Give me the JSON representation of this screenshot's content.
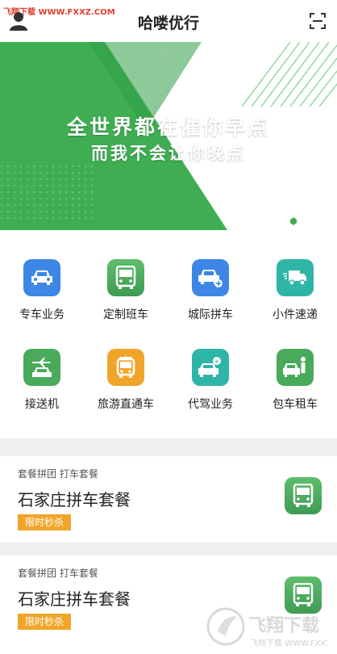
{
  "header": {
    "watermark": "飞翔下载 WWW.FXXZ.COM",
    "title": "哈喽优行"
  },
  "banner": {
    "line1": "全世界都在催你早点",
    "line2": "而我不会让你晚点"
  },
  "services": [
    {
      "label": "专车业务",
      "icon": "car-icon",
      "color": "#3d86e6"
    },
    {
      "label": "定制班车",
      "icon": "bus-icon",
      "color": "#4aaa5c"
    },
    {
      "label": "城际拼车",
      "icon": "car-plus-icon",
      "color": "#3d86e6"
    },
    {
      "label": "小件速递",
      "icon": "truck-icon",
      "color": "#2fb5a8"
    },
    {
      "label": "接送机",
      "icon": "plane-car-icon",
      "color": "#4aaa5c"
    },
    {
      "label": "旅游直通车",
      "icon": "tour-bus-icon",
      "color": "#f0a52a"
    },
    {
      "label": "代驾业务",
      "icon": "driver-car-icon",
      "color": "#2fb5a8"
    },
    {
      "label": "包车租车",
      "icon": "rental-car-icon",
      "color": "#4aaa5c"
    }
  ],
  "packages": [
    {
      "tags": "套餐拼团  打车套餐",
      "name": "石家庄拼车套餐",
      "badge": "限时秒杀"
    },
    {
      "tags": "套餐拼团  打车套餐",
      "name": "石家庄拼车套餐",
      "badge": "限时秒杀"
    }
  ],
  "watermark_bottom": "飞翔下载 WWW.FXXZ.COM"
}
